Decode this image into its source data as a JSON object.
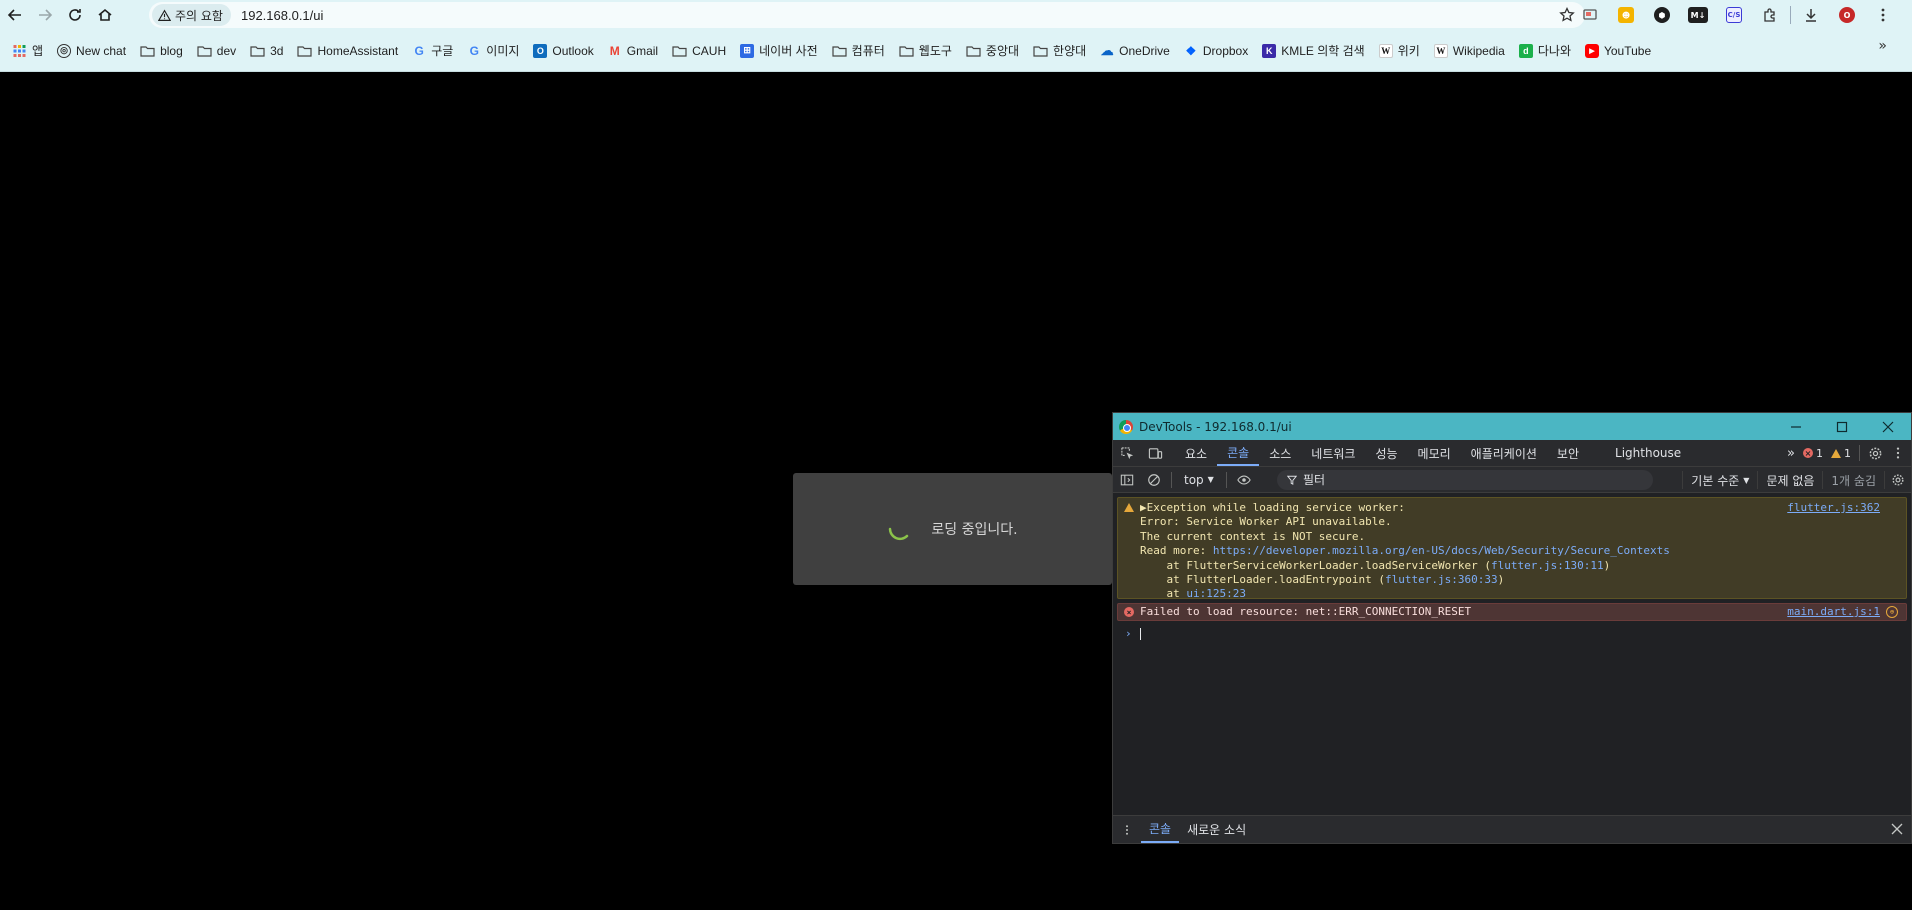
{
  "browser": {
    "security_chip": "주의 요함",
    "url": "192.168.0.1/ui",
    "bookmarks": [
      {
        "label": "앱",
        "icon": "apps-grid-icon"
      },
      {
        "label": "New chat",
        "icon": "openai-icon"
      },
      {
        "label": "blog",
        "icon": "folder-icon"
      },
      {
        "label": "dev",
        "icon": "folder-icon"
      },
      {
        "label": "3d",
        "icon": "folder-icon"
      },
      {
        "label": "HomeAssistant",
        "icon": "folder-icon"
      },
      {
        "label": "구글",
        "icon": "google-icon"
      },
      {
        "label": "이미지",
        "icon": "google-icon"
      },
      {
        "label": "Outlook",
        "icon": "outlook-icon"
      },
      {
        "label": "Gmail",
        "icon": "gmail-icon"
      },
      {
        "label": "CAUH",
        "icon": "folder-icon"
      },
      {
        "label": "네이버 사전",
        "icon": "naver-dict-icon"
      },
      {
        "label": "컴퓨터",
        "icon": "folder-icon"
      },
      {
        "label": "웹도구",
        "icon": "folder-icon"
      },
      {
        "label": "중앙대",
        "icon": "folder-icon"
      },
      {
        "label": "한양대",
        "icon": "folder-icon"
      },
      {
        "label": "OneDrive",
        "icon": "onedrive-icon"
      },
      {
        "label": "Dropbox",
        "icon": "dropbox-icon"
      },
      {
        "label": "KMLE 의학 검색",
        "icon": "kmle-icon"
      },
      {
        "label": "위키",
        "icon": "wikipedia-icon"
      },
      {
        "label": "Wikipedia",
        "icon": "wikipedia-icon"
      },
      {
        "label": "다나와",
        "icon": "danawa-icon"
      },
      {
        "label": "YouTube",
        "icon": "youtube-icon"
      }
    ],
    "extensions": [
      "cast-icon",
      "yellow-extension-icon",
      "hex-extension-icon",
      "markdown-extension-icon",
      "css-extension-icon",
      "puzzle-icon",
      "download-icon",
      "profile-icon",
      "menu-kebab-icon"
    ],
    "extension_labels": {
      "m4": "M↓",
      "cs": "C/S"
    }
  },
  "page": {
    "loading_text": "로딩 중입니다."
  },
  "devtools": {
    "title": "DevTools - 192.168.0.1/ui",
    "tabs": [
      "요소",
      "콘솔",
      "소스",
      "네트워크",
      "성능",
      "메모리",
      "애플리케이션",
      "보안",
      "Lighthouse"
    ],
    "active_tab": "콘솔",
    "error_count": "1",
    "warning_count": "1",
    "context": "top",
    "filter_placeholder": "필터",
    "level": "기본 수준",
    "issues": "문제 없음",
    "hidden": "1개 숨김",
    "warning": {
      "lines": [
        "Exception while loading service worker:",
        "Error: Service Worker API unavailable.",
        "The current context is NOT secure.",
        "Read more: "
      ],
      "link": "https://developer.mozilla.org/en-US/docs/Web/Security/Secure_Contexts",
      "stack": [
        {
          "prefix": "    at FlutterServiceWorkerLoader.loadServiceWorker (",
          "ref": "flutter.js:130:11",
          "suffix": ")"
        },
        {
          "prefix": "    at FlutterLoader.loadEntrypoint (",
          "ref": "flutter.js:360:33",
          "suffix": ")"
        },
        {
          "prefix": "    at ",
          "ref": "ui:125:23",
          "suffix": ""
        }
      ],
      "source": "flutter.js:362"
    },
    "error": {
      "text": "Failed to load resource: net::ERR_CONNECTION_RESET",
      "source": "main.dart.js:1"
    },
    "drawer_tabs": [
      "콘솔",
      "새로운 소식"
    ]
  },
  "colors": {
    "chrome_bg": "#dff3f6",
    "devtools_title": "#4bb6c3",
    "accent_blue": "#7cacf8",
    "warn_bg": "#413c26",
    "error_bg": "#4e3534",
    "spinner": "#8bc34a"
  }
}
